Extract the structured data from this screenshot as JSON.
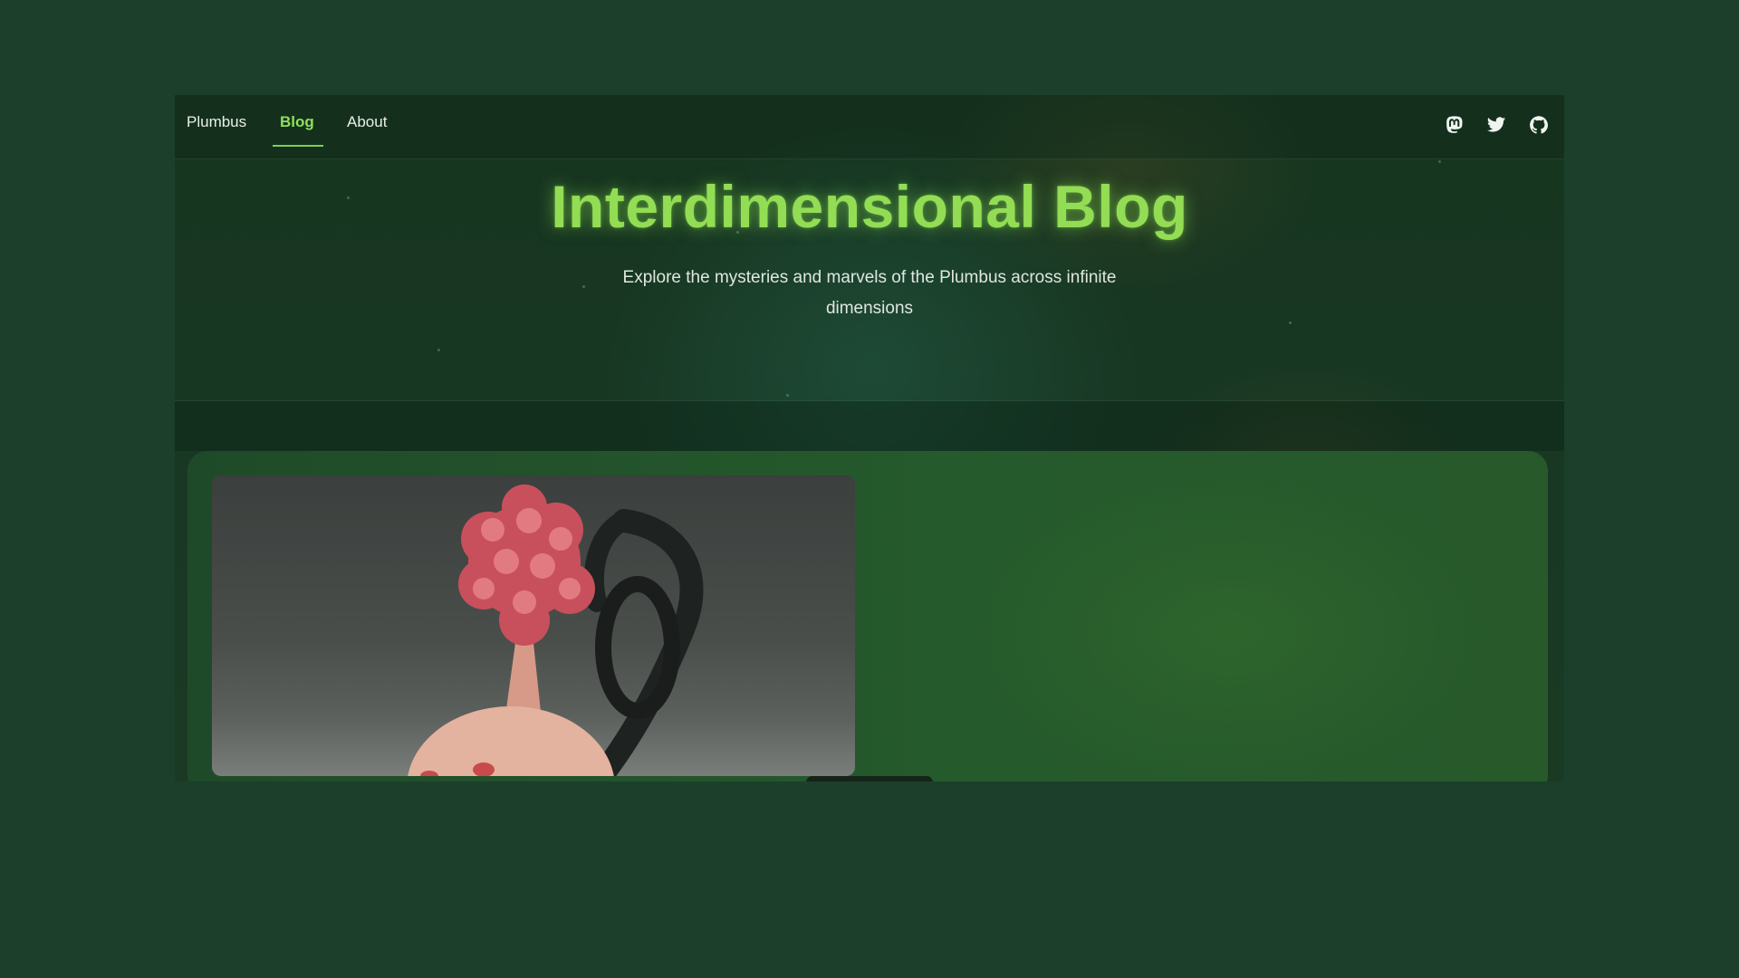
{
  "nav": {
    "items": [
      {
        "label": "Plumbus",
        "active": false
      },
      {
        "label": "Blog",
        "active": true
      },
      {
        "label": "About",
        "active": false
      }
    ],
    "social_icons": [
      "mastodon-icon",
      "twitter-icon",
      "github-icon"
    ]
  },
  "hero": {
    "title": "Interdimensional Blog",
    "subtitle": "Explore the mysteries and marvels of the Plumbus across infinite dimensions"
  },
  "featured_post": {
    "image": "plumbus-photo"
  },
  "colors": {
    "accent": "#8fe05a",
    "background": "#1b3f2b",
    "text": "#e8efe8"
  }
}
